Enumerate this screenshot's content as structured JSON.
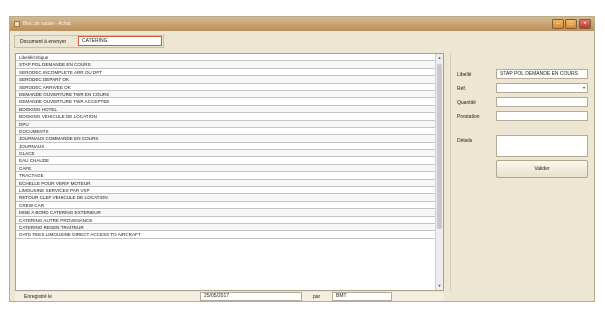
{
  "window": {
    "title": "Bloc de saisie - Achat",
    "minimize_glyph": "–",
    "maximize_glyph": "□",
    "close_glyph": "×"
  },
  "document": {
    "label": "Document à envoyer",
    "value": "CATERING"
  },
  "list": {
    "items": [
      "Libellé/critique",
      "STAP POL DEMANDE EN COURS",
      "SERODEC INCOMPLETE ARR OU DPT",
      "SERODEC DEPART OK",
      "SERODEC ARRIVEE OK",
      "DEMANDE OUVERTURE TWR EN COURS",
      "DEMANDE OUVERTURE TWR ACCEPTEE",
      "BOOKING HOTEL",
      "BOOKING VEHICULE DE LOCATION",
      "DPU",
      "DOCUMENTS",
      "JOURNAUX COMMANDE EN COURS",
      "JOURNAUX",
      "GLACE",
      "EAU CHAUDE",
      "CAFE",
      "TRACTAGE",
      "ECHELLE POUR VERIF MOTEUR",
      "LIMOUSINE SERVICES PAR VSP",
      "RETOUR CLEF VEHICULE DE LOCATION",
      "CREW CAR",
      "MISE A BORD CATERING EXTERIEUR",
      "CATERING AUTRE PROVENANCE",
      "CATERING RESEN TRAITEUR",
      "GATE FEES LIMOUSINE DIRECT ACCESS TO AIRCRAFT"
    ],
    "scroll_up_glyph": "▲",
    "scroll_down_glyph": "▼"
  },
  "footer": {
    "label": "Enregistré le",
    "date": "25/05/2017",
    "par_label": "par",
    "user": "BMT"
  },
  "detail": {
    "libelle_label": "Libellé",
    "libelle_value": "STAP POL DEMANDE EN COURS",
    "ref_label": "Réf.",
    "ref_value": "",
    "combo_arrow": "▾",
    "quantite_label": "Quantité",
    "quantite_value": "",
    "prestation_label": "Prestation",
    "prestation_value": "",
    "details_label": "Détails",
    "details_value": "",
    "valider_label": "Valider"
  }
}
